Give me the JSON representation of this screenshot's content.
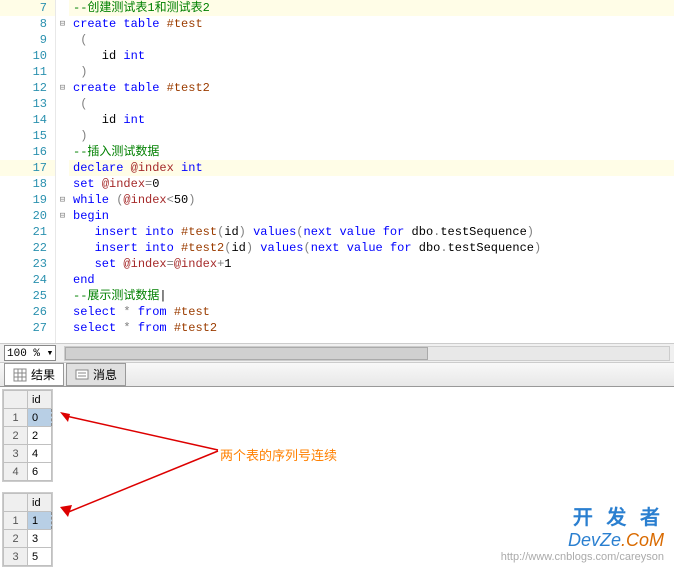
{
  "code": {
    "lines": [
      {
        "n": 7,
        "hl": true,
        "fold": "",
        "segs": [
          {
            "c": "comment",
            "t": "--创建测试表1和测试表2"
          }
        ]
      },
      {
        "n": 8,
        "hl": false,
        "fold": "⊟",
        "segs": [
          {
            "c": "kw",
            "t": "create"
          },
          {
            "c": "",
            "t": " "
          },
          {
            "c": "kw",
            "t": "table"
          },
          {
            "c": "",
            "t": " "
          },
          {
            "c": "temp",
            "t": "#test"
          }
        ]
      },
      {
        "n": 9,
        "hl": false,
        "fold": "",
        "segs": [
          {
            "c": "op",
            "t": " ("
          }
        ]
      },
      {
        "n": 10,
        "hl": false,
        "fold": "",
        "segs": [
          {
            "c": "",
            "t": "    id "
          },
          {
            "c": "kw",
            "t": "int"
          }
        ]
      },
      {
        "n": 11,
        "hl": false,
        "fold": "",
        "segs": [
          {
            "c": "op",
            "t": " )"
          }
        ]
      },
      {
        "n": 12,
        "hl": false,
        "fold": "⊟",
        "segs": [
          {
            "c": "kw",
            "t": "create"
          },
          {
            "c": "",
            "t": " "
          },
          {
            "c": "kw",
            "t": "table"
          },
          {
            "c": "",
            "t": " "
          },
          {
            "c": "temp",
            "t": "#test2"
          }
        ]
      },
      {
        "n": 13,
        "hl": false,
        "fold": "",
        "segs": [
          {
            "c": "op",
            "t": " ("
          }
        ]
      },
      {
        "n": 14,
        "hl": false,
        "fold": "",
        "segs": [
          {
            "c": "",
            "t": "    id "
          },
          {
            "c": "kw",
            "t": "int"
          }
        ]
      },
      {
        "n": 15,
        "hl": false,
        "fold": "",
        "segs": [
          {
            "c": "op",
            "t": " )"
          }
        ]
      },
      {
        "n": 16,
        "hl": false,
        "fold": "",
        "segs": [
          {
            "c": "comment",
            "t": "--插入测试数据"
          }
        ]
      },
      {
        "n": 17,
        "hl": true,
        "fold": "",
        "segs": [
          {
            "c": "kw",
            "t": "declare"
          },
          {
            "c": "",
            "t": " "
          },
          {
            "c": "var",
            "t": "@index"
          },
          {
            "c": "",
            "t": " "
          },
          {
            "c": "kw",
            "t": "int"
          }
        ]
      },
      {
        "n": 18,
        "hl": false,
        "fold": "",
        "segs": [
          {
            "c": "kw",
            "t": "set"
          },
          {
            "c": "",
            "t": " "
          },
          {
            "c": "var",
            "t": "@index"
          },
          {
            "c": "op",
            "t": "="
          },
          {
            "c": "num",
            "t": "0"
          }
        ]
      },
      {
        "n": 19,
        "hl": false,
        "fold": "⊟",
        "segs": [
          {
            "c": "kw",
            "t": "while"
          },
          {
            "c": "",
            "t": " "
          },
          {
            "c": "op",
            "t": "("
          },
          {
            "c": "var",
            "t": "@index"
          },
          {
            "c": "op",
            "t": "<"
          },
          {
            "c": "num",
            "t": "50"
          },
          {
            "c": "op",
            "t": ")"
          }
        ]
      },
      {
        "n": 20,
        "hl": false,
        "fold": "⊟",
        "segs": [
          {
            "c": "kw",
            "t": "begin"
          }
        ]
      },
      {
        "n": 21,
        "hl": false,
        "fold": "",
        "segs": [
          {
            "c": "",
            "t": "   "
          },
          {
            "c": "kw",
            "t": "insert"
          },
          {
            "c": "",
            "t": " "
          },
          {
            "c": "kw",
            "t": "into"
          },
          {
            "c": "",
            "t": " "
          },
          {
            "c": "temp",
            "t": "#test"
          },
          {
            "c": "op",
            "t": "("
          },
          {
            "c": "",
            "t": "id"
          },
          {
            "c": "op",
            "t": ")"
          },
          {
            "c": "",
            "t": " "
          },
          {
            "c": "kw",
            "t": "values"
          },
          {
            "c": "op",
            "t": "("
          },
          {
            "c": "kw",
            "t": "next"
          },
          {
            "c": "",
            "t": " "
          },
          {
            "c": "kw",
            "t": "value"
          },
          {
            "c": "",
            "t": " "
          },
          {
            "c": "kw",
            "t": "for"
          },
          {
            "c": "",
            "t": " dbo"
          },
          {
            "c": "op",
            "t": "."
          },
          {
            "c": "",
            "t": "testSequence"
          },
          {
            "c": "op",
            "t": ")"
          }
        ]
      },
      {
        "n": 22,
        "hl": false,
        "fold": "",
        "segs": [
          {
            "c": "",
            "t": "   "
          },
          {
            "c": "kw",
            "t": "insert"
          },
          {
            "c": "",
            "t": " "
          },
          {
            "c": "kw",
            "t": "into"
          },
          {
            "c": "",
            "t": " "
          },
          {
            "c": "temp",
            "t": "#test2"
          },
          {
            "c": "op",
            "t": "("
          },
          {
            "c": "",
            "t": "id"
          },
          {
            "c": "op",
            "t": ")"
          },
          {
            "c": "",
            "t": " "
          },
          {
            "c": "kw",
            "t": "values"
          },
          {
            "c": "op",
            "t": "("
          },
          {
            "c": "kw",
            "t": "next"
          },
          {
            "c": "",
            "t": " "
          },
          {
            "c": "kw",
            "t": "value"
          },
          {
            "c": "",
            "t": " "
          },
          {
            "c": "kw",
            "t": "for"
          },
          {
            "c": "",
            "t": " dbo"
          },
          {
            "c": "op",
            "t": "."
          },
          {
            "c": "",
            "t": "testSequence"
          },
          {
            "c": "op",
            "t": ")"
          }
        ]
      },
      {
        "n": 23,
        "hl": false,
        "fold": "",
        "segs": [
          {
            "c": "",
            "t": "   "
          },
          {
            "c": "kw",
            "t": "set"
          },
          {
            "c": "",
            "t": " "
          },
          {
            "c": "var",
            "t": "@index"
          },
          {
            "c": "op",
            "t": "="
          },
          {
            "c": "var",
            "t": "@index"
          },
          {
            "c": "op",
            "t": "+"
          },
          {
            "c": "num",
            "t": "1"
          }
        ]
      },
      {
        "n": 24,
        "hl": false,
        "fold": "",
        "segs": [
          {
            "c": "kw",
            "t": "end"
          }
        ]
      },
      {
        "n": 25,
        "hl": false,
        "fold": "",
        "segs": [
          {
            "c": "comment",
            "t": "--展示测试数据"
          },
          {
            "c": "",
            "t": "|"
          }
        ]
      },
      {
        "n": 26,
        "hl": false,
        "fold": "",
        "segs": [
          {
            "c": "kw",
            "t": "select"
          },
          {
            "c": "",
            "t": " "
          },
          {
            "c": "op",
            "t": "*"
          },
          {
            "c": "",
            "t": " "
          },
          {
            "c": "kw",
            "t": "from"
          },
          {
            "c": "",
            "t": " "
          },
          {
            "c": "temp",
            "t": "#test"
          }
        ]
      },
      {
        "n": 27,
        "hl": false,
        "fold": "",
        "segs": [
          {
            "c": "kw",
            "t": "select"
          },
          {
            "c": "",
            "t": " "
          },
          {
            "c": "op",
            "t": "*"
          },
          {
            "c": "",
            "t": " "
          },
          {
            "c": "kw",
            "t": "from"
          },
          {
            "c": "",
            "t": " "
          },
          {
            "c": "temp",
            "t": "#test2"
          }
        ]
      }
    ]
  },
  "zoom": "100 %",
  "tabs": {
    "results": "结果",
    "messages": "消息"
  },
  "grid1": {
    "header": "id",
    "rows": [
      {
        "r": "1",
        "v": "0"
      },
      {
        "r": "2",
        "v": "2"
      },
      {
        "r": "3",
        "v": "4"
      },
      {
        "r": "4",
        "v": "6"
      }
    ]
  },
  "grid2": {
    "header": "id",
    "rows": [
      {
        "r": "1",
        "v": "1"
      },
      {
        "r": "2",
        "v": "3"
      },
      {
        "r": "3",
        "v": "5"
      }
    ]
  },
  "annotation": "两个表的序列号连续",
  "watermark": {
    "line1": "开 发 者",
    "dev": "DevZe",
    "com": ".CoM",
    "url": "http://www.cnblogs.com/careyson"
  }
}
